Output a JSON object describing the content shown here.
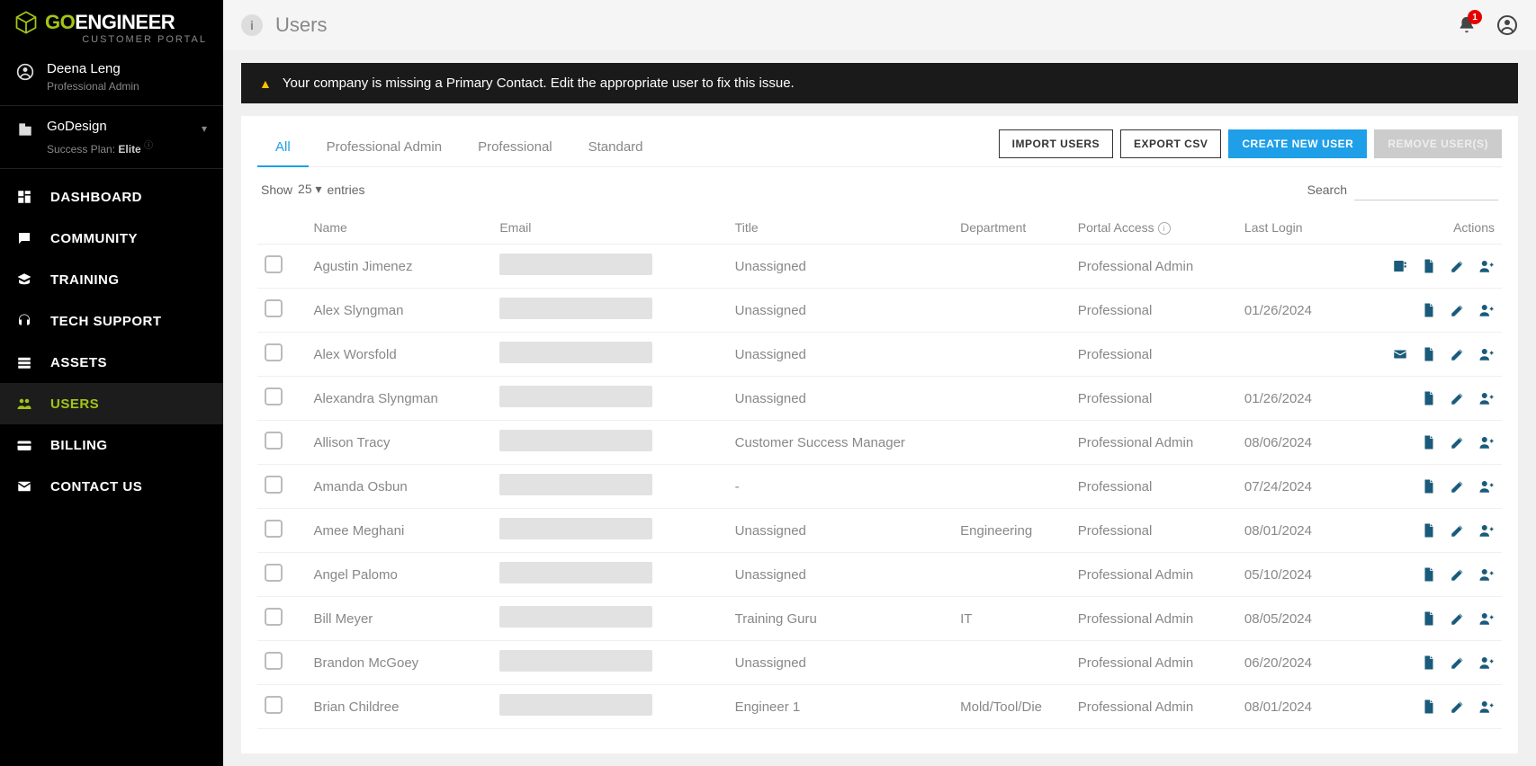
{
  "brand": {
    "part1": "GO",
    "part2": "ENGINEER",
    "sub": "CUSTOMER PORTAL"
  },
  "user": {
    "name": "Deena Leng",
    "role": "Professional Admin"
  },
  "company": {
    "name": "GoDesign",
    "plan_label": "Success Plan:",
    "plan_value": "Elite"
  },
  "nav": {
    "dashboard": "DASHBOARD",
    "community": "COMMUNITY",
    "training": "TRAINING",
    "techsupport": "TECH SUPPORT",
    "assets": "ASSETS",
    "users": "USERS",
    "billing": "BILLING",
    "contact": "CONTACT US"
  },
  "topbar": {
    "title": "Users",
    "badge": "1"
  },
  "alert": {
    "text": "Your company is missing a Primary Contact. Edit the appropriate user to fix this issue."
  },
  "tabs": {
    "all": "All",
    "profadmin": "Professional Admin",
    "prof": "Professional",
    "standard": "Standard"
  },
  "buttons": {
    "import": "IMPORT USERS",
    "export": "EXPORT CSV",
    "create": "CREATE NEW USER",
    "remove": "REMOVE USER(S)"
  },
  "controls": {
    "show": "Show",
    "count": "25",
    "entries": "entries",
    "search": "Search"
  },
  "columns": {
    "name": "Name",
    "email": "Email",
    "title": "Title",
    "department": "Department",
    "access": "Portal Access",
    "login": "Last Login",
    "actions": "Actions"
  },
  "rows": [
    {
      "name": "Agustin Jimenez",
      "title": "Unassigned",
      "dept": "",
      "access": "Professional Admin",
      "login": "",
      "icons": [
        "contact",
        "doc",
        "edit",
        "user"
      ]
    },
    {
      "name": "Alex Slyngman",
      "title": "Unassigned",
      "dept": "",
      "access": "Professional",
      "login": "01/26/2024",
      "icons": [
        "doc",
        "edit",
        "user"
      ]
    },
    {
      "name": "Alex Worsfold",
      "title": "Unassigned",
      "dept": "",
      "access": "Professional",
      "login": "",
      "icons": [
        "mail",
        "doc",
        "edit",
        "user"
      ]
    },
    {
      "name": "Alexandra Slyngman",
      "title": "Unassigned",
      "dept": "",
      "access": "Professional",
      "login": "01/26/2024",
      "icons": [
        "doc",
        "edit",
        "user"
      ]
    },
    {
      "name": "Allison Tracy",
      "title": "Customer Success Manager",
      "dept": "",
      "access": "Professional Admin",
      "login": "08/06/2024",
      "icons": [
        "doc",
        "edit",
        "user"
      ]
    },
    {
      "name": "Amanda Osbun",
      "title": "-",
      "dept": "",
      "access": "Professional",
      "login": "07/24/2024",
      "icons": [
        "doc",
        "edit",
        "user"
      ]
    },
    {
      "name": "Amee Meghani",
      "title": "Unassigned",
      "dept": "Engineering",
      "access": "Professional",
      "login": "08/01/2024",
      "icons": [
        "doc",
        "edit",
        "user"
      ]
    },
    {
      "name": "Angel Palomo",
      "title": "Unassigned",
      "dept": "",
      "access": "Professional Admin",
      "login": "05/10/2024",
      "icons": [
        "doc",
        "edit",
        "user"
      ]
    },
    {
      "name": "Bill Meyer",
      "title": "Training Guru",
      "dept": "IT",
      "access": "Professional Admin",
      "login": "08/05/2024",
      "icons": [
        "doc",
        "edit",
        "user"
      ]
    },
    {
      "name": "Brandon McGoey",
      "title": "Unassigned",
      "dept": "",
      "access": "Professional Admin",
      "login": "06/20/2024",
      "icons": [
        "doc",
        "edit",
        "user"
      ]
    },
    {
      "name": "Brian Childree",
      "title": "Engineer 1",
      "dept": "Mold/Tool/Die",
      "access": "Professional Admin",
      "login": "08/01/2024",
      "icons": [
        "doc",
        "edit",
        "user"
      ]
    }
  ]
}
